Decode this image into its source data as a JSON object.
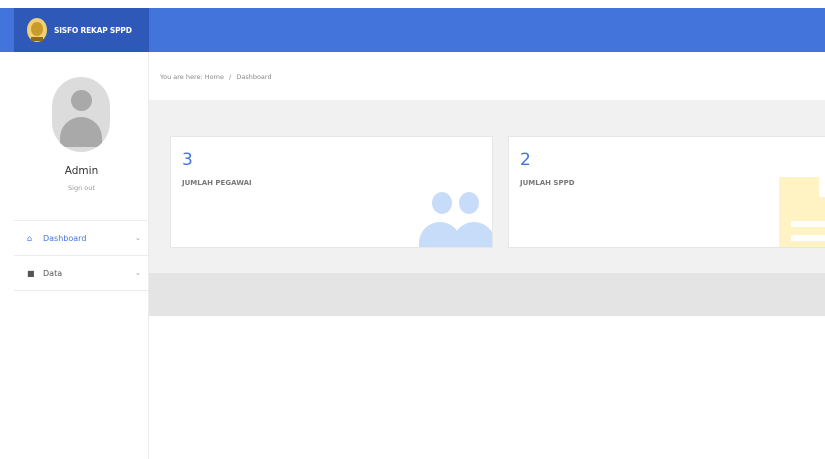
{
  "app": {
    "brand": "SISFO REKAP SPPD"
  },
  "user": {
    "name": "Admin",
    "signout": "Sign out"
  },
  "sidebar": {
    "items": [
      {
        "label": "Dashboard",
        "icon": "home-icon",
        "active": true
      },
      {
        "label": "Data",
        "icon": "folder-icon",
        "active": false
      }
    ]
  },
  "breadcrumb": {
    "prefix": "You are here:",
    "items": [
      "Home",
      "Dashboard"
    ]
  },
  "cards": [
    {
      "count": "3",
      "title": "JUMLAH PEGAWAI",
      "icon": "users-icon"
    },
    {
      "count": "2",
      "title": "JUMLAH SPPD",
      "icon": "file-icon"
    }
  ],
  "colors": {
    "accent": "#4374dc",
    "brand_bg": "#2f59b8",
    "icon_blue": "#c6dcf8",
    "icon_yellow": "#fff3c4"
  }
}
